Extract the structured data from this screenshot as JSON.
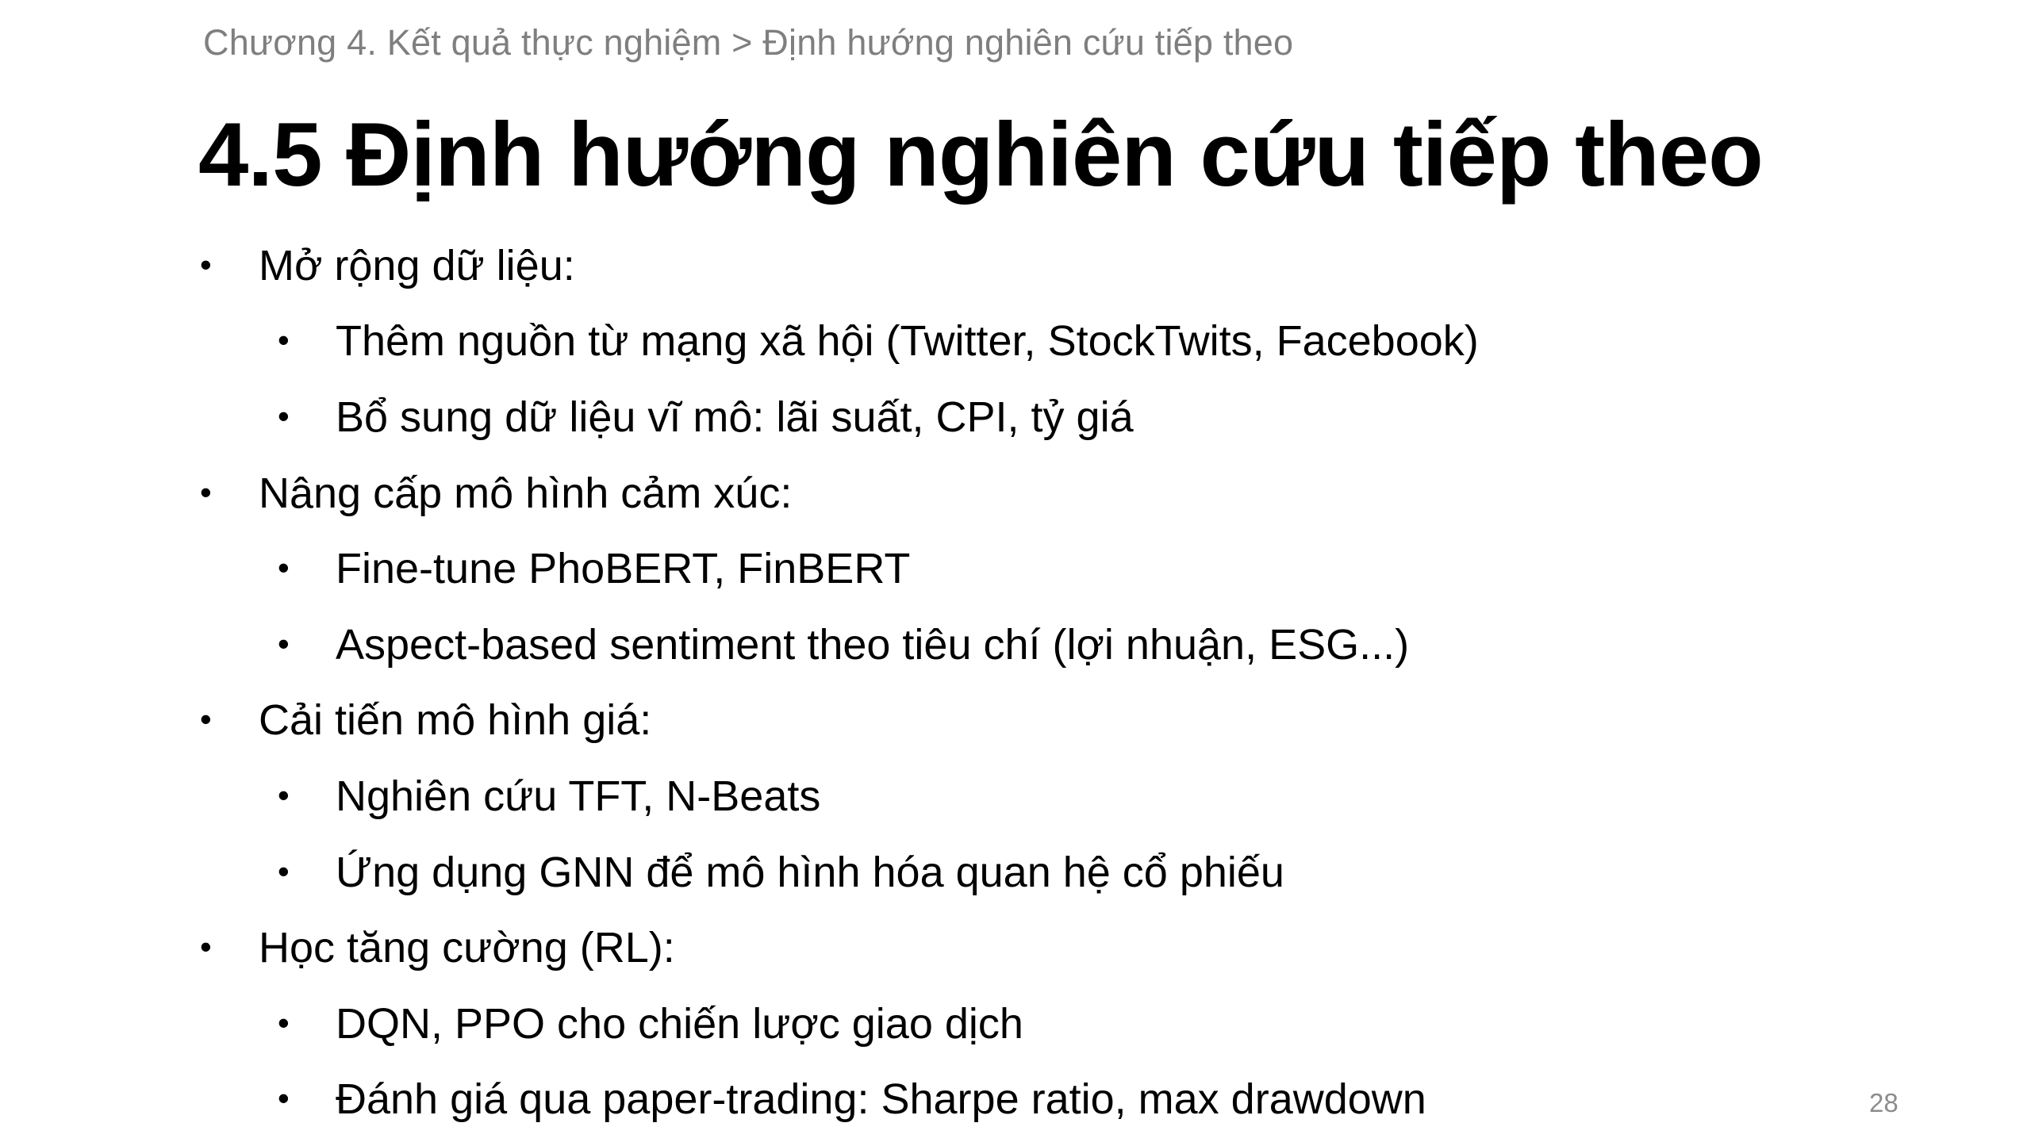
{
  "breadcrumb": "Chương 4. Kết quả thực nghiệm > Định hướng nghiên cứu tiếp theo",
  "title": "4.5 Định hướng nghiên cứu tiếp theo",
  "bullet_symbol": "•",
  "sections": [
    {
      "heading": "Mở rộng dữ liệu:",
      "items": [
        "Thêm nguồn từ mạng xã hội (Twitter, StockTwits, Facebook)",
        "Bổ sung dữ liệu vĩ mô: lãi suất, CPI, tỷ giá"
      ]
    },
    {
      "heading": "Nâng cấp mô hình cảm xúc:",
      "items": [
        "Fine-tune PhoBERT, FinBERT",
        "Aspect-based sentiment theo tiêu chí (lợi nhuận, ESG...)"
      ]
    },
    {
      "heading": "Cải tiến mô hình giá:",
      "items": [
        "Nghiên cứu TFT, N-Beats",
        "Ứng dụng GNN để mô hình hóa quan hệ cổ phiếu"
      ]
    },
    {
      "heading": "Học tăng cường (RL):",
      "items": [
        "DQN, PPO cho chiến lược giao dịch",
        "Đánh giá qua paper-trading: Sharpe ratio, max drawdown"
      ]
    }
  ],
  "page_number": "28"
}
